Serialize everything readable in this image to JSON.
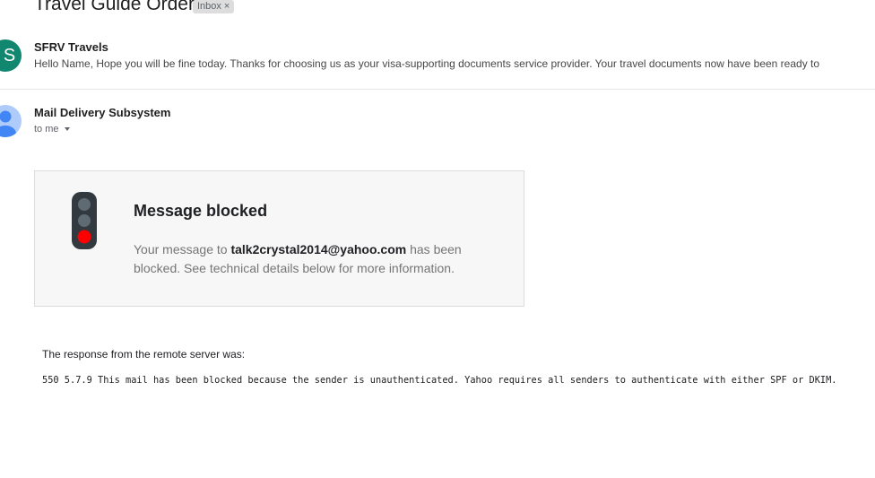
{
  "thread": {
    "subject": "Travel Guide Order",
    "label_chip": "Inbox",
    "label_chip_close": "×"
  },
  "messages": [
    {
      "avatar_letter": "S",
      "avatar_color": "#12876f",
      "sender": "SFRV Travels",
      "snippet": "Hello Name, Hope you will be fine today. Thanks for choosing us as your visa-supporting documents service provider. Your travel documents now have been ready to"
    },
    {
      "avatar_icon": "person-icon",
      "avatar_color": "#aecbfa",
      "sender": "Mail Delivery Subsystem",
      "recipient": "to me"
    }
  ],
  "bounce": {
    "icon": "traffic-light-icon",
    "title": "Message blocked",
    "body_prefix": "Your message to",
    "email": "talk2crystal2014@yahoo.com",
    "body_suffix": "has been blocked. See technical details below for more information.",
    "response_label": "The response from the remote server was:",
    "response_code": "550 5.7.9 This mail has been blocked because the sender is unauthenticated. Yahoo requires all senders to authenticate with either SPF or DKIM.",
    "colors": {
      "light_red": "#ff0000",
      "light_off": "#5f6b73",
      "light_body": "#333a3f"
    }
  }
}
